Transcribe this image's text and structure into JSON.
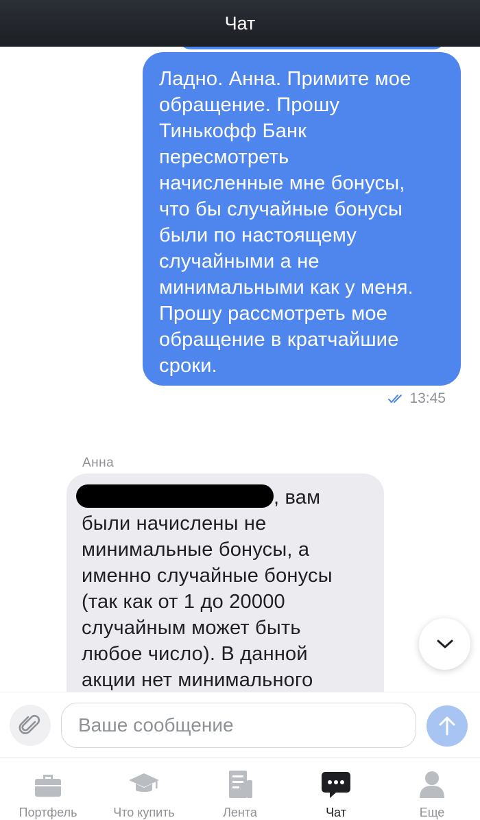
{
  "header": {
    "title": "Чат"
  },
  "messages": {
    "outgoing": {
      "lines": [
        "Ладно. Анна. Примите мое",
        "обращение. Прошу",
        "Тинькофф Банк",
        "пересмотреть",
        "начисленные мне бонусы,",
        "что бы случайные бонусы",
        "были по настоящему",
        "случайными а не",
        "минимальными как у меня.",
        "Прошу рассмотреть мое",
        "обращение в кратчайшие",
        "сроки."
      ],
      "time": "13:45"
    },
    "incoming": {
      "sender": "Анна",
      "first_line_tail": ", вам",
      "lines": [
        "были начислены не",
        "минимальные бонусы, а",
        "именно случайные бонусы",
        "(так как от 1 до 20000",
        "случайным может быть",
        "любое число). В данной",
        "акции нет минимального"
      ]
    }
  },
  "composer": {
    "placeholder": "Ваше сообщение"
  },
  "tabbar": {
    "items": [
      {
        "label": "Портфель",
        "icon": "briefcase-icon"
      },
      {
        "label": "Что купить",
        "icon": "graduation-cap-icon"
      },
      {
        "label": "Лента",
        "icon": "news-feed-icon"
      },
      {
        "label": "Чат",
        "icon": "chat-bubble-icon",
        "active": true
      },
      {
        "label": "Еще",
        "icon": "user-icon"
      }
    ]
  },
  "colors": {
    "outgoing_bubble": "#4f86ee",
    "incoming_bubble": "#ececf0",
    "send_button": "#a7c4f3",
    "header": "#22262b"
  }
}
